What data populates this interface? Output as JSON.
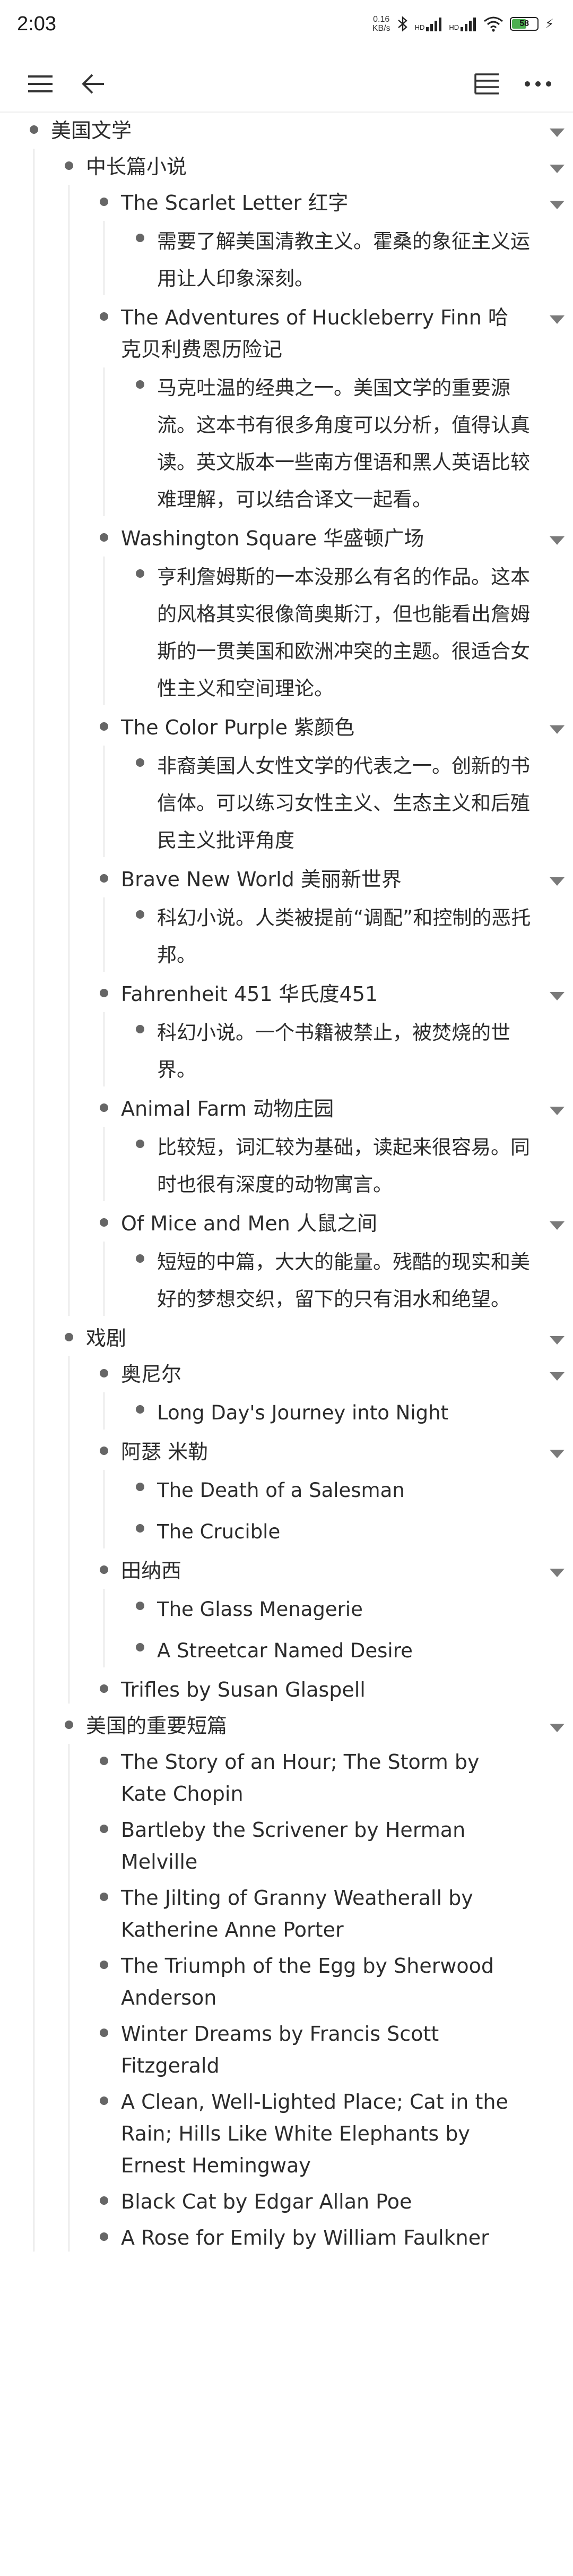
{
  "status": {
    "time": "2:03",
    "net_speed_value": "0.16",
    "net_speed_unit": "KB/s",
    "battery": "58",
    "battery_level_pct": 58,
    "signal1_label": "HD",
    "signal2_label": "HD"
  },
  "toolbar": {
    "menu_icon": "hamburger-icon",
    "back_icon": "arrow-left-icon",
    "outline_icon": "outline-tree-icon",
    "more_icon": "more-horizontal-icon"
  },
  "outline": [
    {
      "text": "美国文学",
      "caret": true,
      "children": [
        {
          "text": "中长篇小说",
          "caret": true,
          "children": [
            {
              "text": "The Scarlet Letter 红字",
              "caret": true,
              "children": [
                {
                  "text": "需要了解美国清教主义。霍桑的象征主义运用让人印象深刻。"
                }
              ]
            },
            {
              "text": "The Adventures of Huckleberry Finn 哈克贝利费恩历险记",
              "caret": true,
              "children": [
                {
                  "text": "马克吐温的经典之一。美国文学的重要源流。这本书有很多角度可以分析，值得认真读。英文版本一些南方俚语和黑人英语比较难理解，可以结合译文一起看。"
                }
              ]
            },
            {
              "text": "Washington Square 华盛顿广场",
              "caret": true,
              "children": [
                {
                  "text": "亨利詹姆斯的一本没那么有名的作品。这本的风格其实很像简奥斯汀，但也能看出詹姆斯的一贯美国和欧洲冲突的主题。很适合女性主义和空间理论。"
                }
              ]
            },
            {
              "text": "The Color Purple 紫颜色",
              "caret": true,
              "children": [
                {
                  "text": "非裔美国人女性文学的代表之一。创新的书信体。可以练习女性主义、生态主义和后殖民主义批评角度"
                }
              ]
            },
            {
              "text": "Brave New World 美丽新世界",
              "caret": true,
              "children": [
                {
                  "text": "科幻小说。人类被提前“调配”和控制的恶托邦。"
                }
              ]
            },
            {
              "text": "Fahrenheit 451 华氏度451",
              "caret": true,
              "children": [
                {
                  "text": "科幻小说。一个书籍被禁止，被焚烧的世界。"
                }
              ]
            },
            {
              "text": "Animal Farm 动物庄园",
              "caret": true,
              "children": [
                {
                  "text": "比较短，词汇较为基础，读起来很容易。同时也很有深度的动物寓言。"
                }
              ]
            },
            {
              "text": "Of Mice and Men 人鼠之间",
              "caret": true,
              "children": [
                {
                  "text": "短短的中篇，大大的能量。残酷的现实和美好的梦想交织，留下的只有泪水和绝望。"
                }
              ]
            }
          ]
        },
        {
          "text": "戏剧",
          "caret": true,
          "children": [
            {
              "text": "奥尼尔",
              "caret": true,
              "children": [
                {
                  "text": "Long Day's Journey into Night"
                }
              ]
            },
            {
              "text": "阿瑟 米勒",
              "caret": true,
              "children": [
                {
                  "text": "The Death of a Salesman"
                },
                {
                  "text": "The Crucible"
                }
              ]
            },
            {
              "text": "田纳西",
              "caret": true,
              "children": [
                {
                  "text": "The Glass Menagerie"
                },
                {
                  "text": "A Streetcar Named Desire"
                }
              ]
            },
            {
              "text": "Trifles by Susan Glaspell"
            }
          ]
        },
        {
          "text": "美国的重要短篇",
          "caret": true,
          "children": [
            {
              "text": "The Story of an Hour; The Storm by Kate Chopin"
            },
            {
              "text": "Bartleby the Scrivener  by Herman Melville"
            },
            {
              "text": "The Jilting of Granny Weatherall by Katherine Anne Porter"
            },
            {
              "text": "The Triumph of the Egg by Sherwood Anderson"
            },
            {
              "text": "Winter Dreams by Francis Scott Fitzgerald"
            },
            {
              "text": "A Clean, Well-Lighted Place; Cat in the Rain; Hills Like White Elephants by Ernest Hemingway"
            },
            {
              "text": "Black Cat by Edgar Allan Poe"
            },
            {
              "text": "A Rose for Emily by William Faulkner"
            }
          ]
        }
      ]
    }
  ]
}
